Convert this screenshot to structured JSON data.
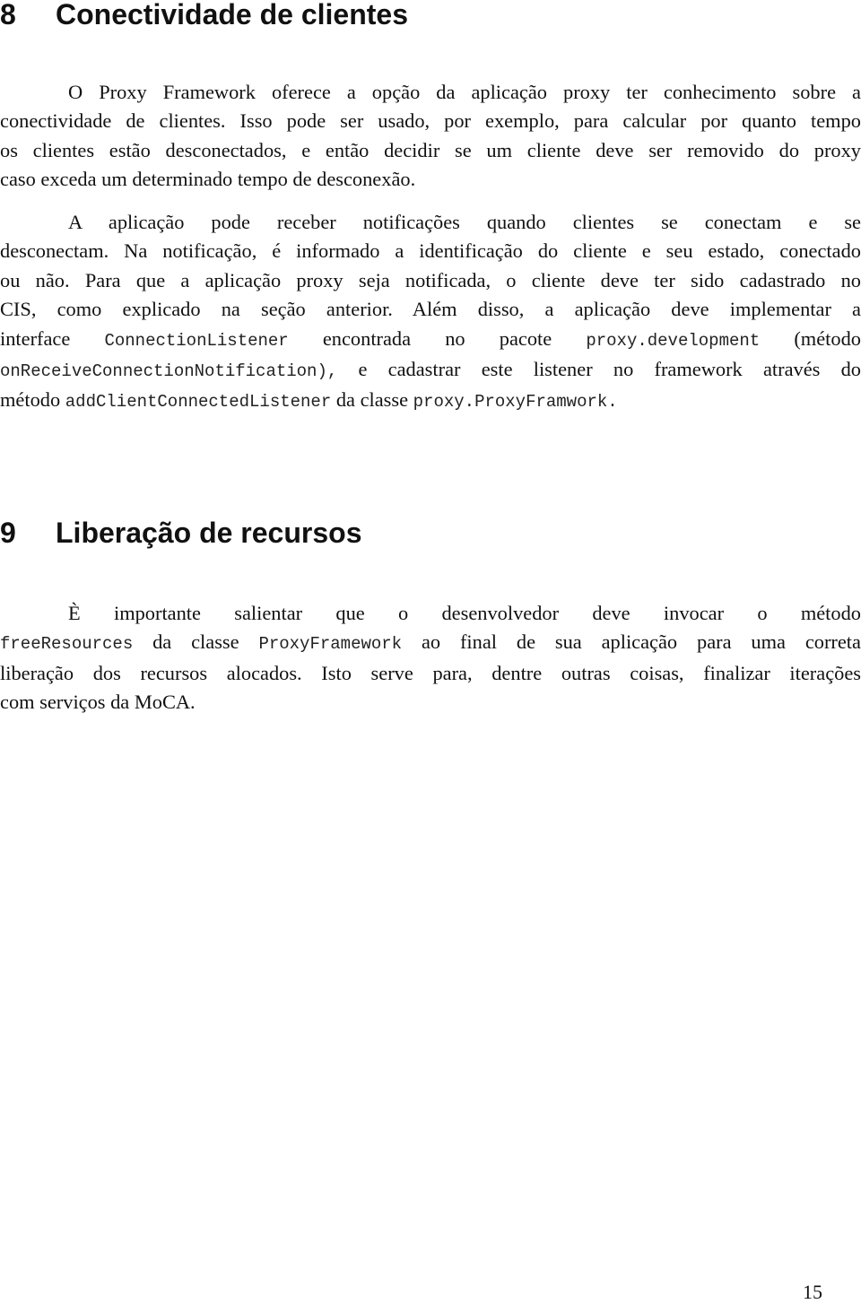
{
  "section8": {
    "number": "8",
    "title": "Conectividade de clientes",
    "p1": {
      "l1": "O Proxy Framework oferece a opção da aplicação proxy ter conhecimento sobre a",
      "l2": "conectividade de clientes. Isso pode ser usado, por exemplo, para calcular por quanto tempo",
      "l3": "os clientes estão desconectados, e então decidir se um cliente deve ser removido do proxy",
      "l4": "caso exceda um determinado tempo de desconexão."
    },
    "p2": {
      "l1": "A aplicação pode receber notificações quando clientes se conectam e se",
      "l2": "desconectam. Na notificação, é informado a identificação do cliente e seu estado, conectado",
      "l3": "ou não. Para que a aplicação proxy seja notificada, o cliente deve ter sido cadastrado no",
      "l4": "CIS, como explicado na seção anterior.  Além disso, a aplicação deve implementar a",
      "l5a": "interface",
      "l5code1": "ConnectionListener",
      "l5b": "encontrada no pacote",
      "l5code2": "proxy.development",
      "l5c": "(método",
      "l6code": "onReceiveConnectionNotification),",
      "l6b": "e cadastrar este listener no framework através do",
      "l7a": "método",
      "l7code1": "addClientConnectedListener",
      "l7b": "da classe",
      "l7code2": "proxy.ProxyFramwork."
    }
  },
  "section9": {
    "number": "9",
    "title": "Liberação de recursos",
    "p1": {
      "l1": "È importante salientar que o desenvolvedor deve invocar o método",
      "l2code1": "freeResources",
      "l2a": "da classe",
      "l2code2": "ProxyFramework",
      "l2b": "ao final de sua aplicação para uma correta",
      "l3": "liberação dos recursos alocados. Isto serve para, dentre outras coisas, finalizar iterações",
      "l4": "com serviços da MoCA."
    }
  },
  "footer": {
    "page_number": "15"
  }
}
